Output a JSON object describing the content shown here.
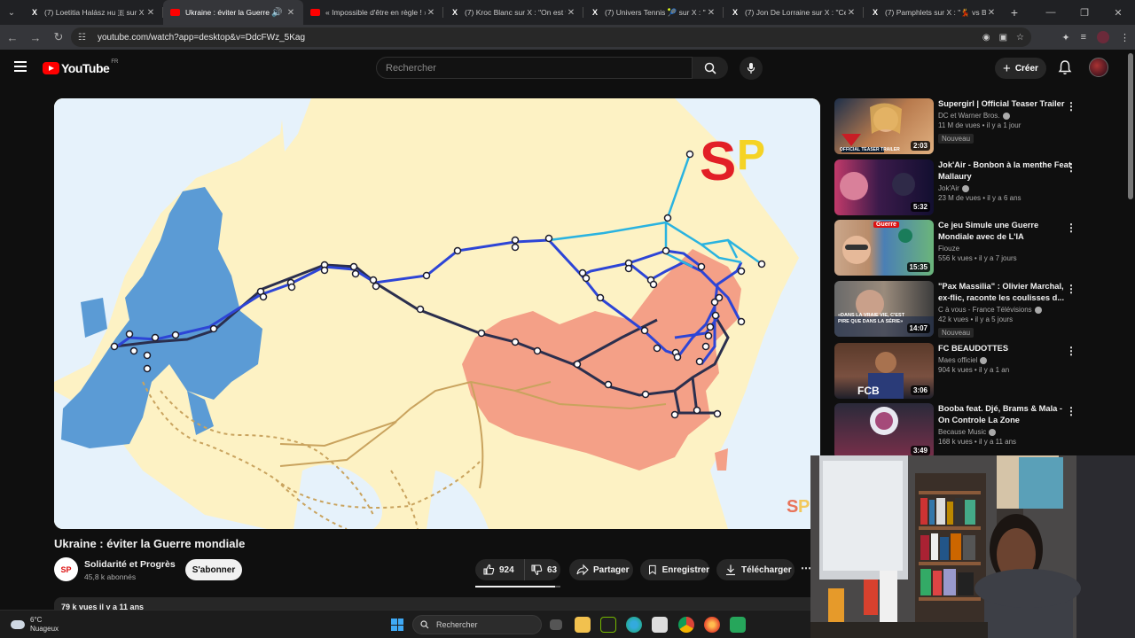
{
  "browser": {
    "tabs": [
      {
        "title": "(7) Loetitia Halász нu 🇧 sur X",
        "icon": "x-logo-icon",
        "active": false
      },
      {
        "title": "Ukraine : éviter la Guerre mondiale",
        "icon": "youtube-icon",
        "active": true
      },
      {
        "title": "« Impossible d'être en règle ! »",
        "icon": "youtube-icon",
        "active": false
      },
      {
        "title": "(7) Kroc Blanc sur X : \"On est vr",
        "icon": "x-logo-icon",
        "active": false
      },
      {
        "title": "(7) Univers Tennis 🎾 sur X : \"a",
        "icon": "x-logo-icon",
        "active": false
      },
      {
        "title": "(7) Jon De Lorraine sur X : \"Ce",
        "icon": "x-logo-icon",
        "active": false
      },
      {
        "title": "(7) Pamphlets sur X : \"💃 vs BR",
        "icon": "x-logo-icon",
        "active": false
      }
    ],
    "url": "youtube.com/watch?app=desktop&v=DdcFWz_5Kag"
  },
  "youtube": {
    "country_code": "FR",
    "search_placeholder": "Rechercher",
    "create_label": "Créer"
  },
  "video": {
    "title": "Ukraine : éviter la Guerre mondiale",
    "channel": "Solidarité et Progrès",
    "subscribers": "45,8 k abonnés",
    "subscribe_label": "S'abonner",
    "likes": "924",
    "dislikes": "63",
    "share_label": "Partager",
    "save_label": "Enregistrer",
    "download_label": "Télécharger",
    "meta": "79 k vues  il y a 11 ans",
    "like_ratio": 0.94,
    "watermark": "SP"
  },
  "sidebar": [
    {
      "title": "Supergirl | Official Teaser Trailer",
      "channel": "DC et Warner Bros.",
      "views": "11 M de vues • il y a 1 jour",
      "duration": "2:03",
      "badge": "Nouveau",
      "thumb_caption": "OFFICIAL TEASER TRAILER"
    },
    {
      "title": "Jok'Air - Bonbon à la menthe Feat Mallaury",
      "channel": "Jok'Air",
      "views": "23 M de vues • il y a 6 ans",
      "duration": "5:32",
      "badge": ""
    },
    {
      "title": "Ce jeu Simule une Guerre Mondiale avec de L'IA",
      "channel": "Fiouze",
      "views": "556 k vues • il y a 7 jours",
      "duration": "15:35",
      "badge": "",
      "thumb_caption": "Guerre"
    },
    {
      "title": "\"Pax Massilia\" : Olivier Marchal, ex-flic, raconte les coulisses d...",
      "channel": "C à vous - France Télévisions",
      "views": "42 k vues • il y a 5 jours",
      "duration": "14:07",
      "badge": "Nouveau",
      "thumb_caption": "«DANS LA VRAIE VIE, C'EST PIRE QUE DANS LA SÉRIE»"
    },
    {
      "title": "FC BEAUDOTTES",
      "channel": "Maes officiel",
      "views": "904 k vues • il y a 1 an",
      "duration": "3:06",
      "badge": "",
      "thumb_caption": "FCB"
    },
    {
      "title": "Booba feat. Djé, Brams & Mala - On Controle La Zone",
      "channel": "Because Music",
      "views": "168 k vues • il y a 11 ans",
      "duration": "3:49",
      "badge": ""
    }
  ],
  "taskbar": {
    "temperature": "6°C",
    "condition": "Nuageux",
    "search_label": "Rechercher"
  },
  "colors": {
    "europe": "#5b9bd5",
    "china": "#f4a087",
    "land": "#fdf2c4",
    "sea": "#e6f2fb",
    "route_dark": "#2b2f4e",
    "route_blue": "#2d45d6",
    "route_cyan": "#2ab3e0",
    "route_gold": "#c9a35e"
  }
}
